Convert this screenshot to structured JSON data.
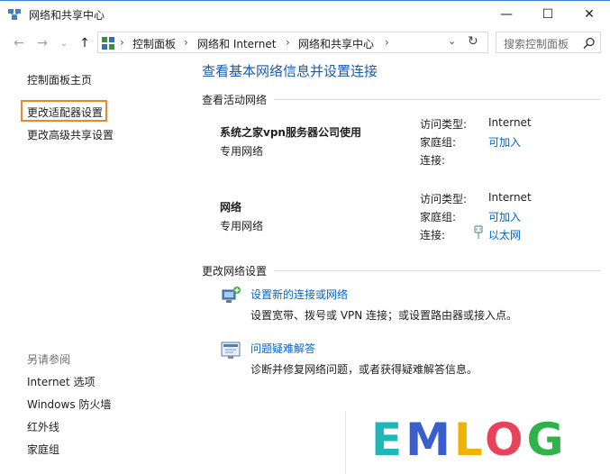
{
  "window": {
    "title": "网络和共享中心"
  },
  "address": {
    "crumbs": [
      "控制面板",
      "网络和 Internet",
      "网络和共享中心"
    ],
    "search_placeholder": "搜索控制面板"
  },
  "sidebar": {
    "home": "控制面板主页",
    "links": [
      "更改适配器设置",
      "更改高级共享设置"
    ],
    "see_also_title": "另请参阅",
    "see_also": [
      "Internet 选项",
      "Windows 防火墙",
      "红外线",
      "家庭组"
    ]
  },
  "main": {
    "heading": "查看基本网络信息并设置连接",
    "active_section": "查看活动网络",
    "networks": [
      {
        "name": "系统之家vpn服务器公司使用",
        "type": "专用网络",
        "access_label": "访问类型:",
        "access_value": "Internet",
        "homegroup_label": "家庭组:",
        "homegroup_value": "可加入",
        "connection_label": "连接:",
        "connection_value": ""
      },
      {
        "name": "网络",
        "type": "专用网络",
        "access_label": "访问类型:",
        "access_value": "Internet",
        "homegroup_label": "家庭组:",
        "homegroup_value": "可加入",
        "connection_label": "连接:",
        "connection_value": "以太网"
      }
    ],
    "change_section": "更改网络设置",
    "tasks": [
      {
        "title": "设置新的连接或网络",
        "desc": "设置宽带、拨号或 VPN 连接；或设置路由器或接入点。"
      },
      {
        "title": "问题疑难解答",
        "desc": "诊断并修复网络问题，或者获得疑难解答信息。"
      }
    ]
  },
  "watermark": "EMLOG",
  "colors": {
    "link": "#0066cc",
    "heading": "#1e5aa8",
    "highlight_border": "#e88a26"
  }
}
